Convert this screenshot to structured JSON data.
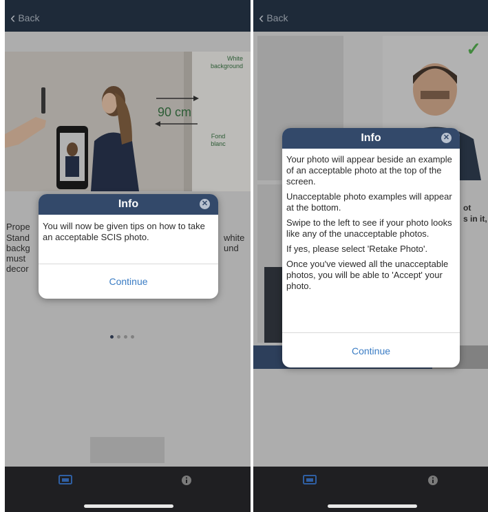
{
  "left": {
    "back_label": "Back",
    "photo": {
      "distance_label": "90 cm",
      "bg_label_en": "White background",
      "bg_label_fr": "Fond blanc"
    },
    "behind_text": {
      "title_partial": "Prope",
      "lines_left": [
        "Stand",
        "backg",
        "must",
        "decor"
      ],
      "lines_right": [
        "white",
        "und"
      ]
    },
    "dialog": {
      "title": "Info",
      "close_icon": "close-icon",
      "message": "You will now be given tips on how to take an acceptable SCIS photo.",
      "continue_label": "Continue"
    },
    "page_dots": {
      "count": 4,
      "active_index": 0
    },
    "tabs": [
      {
        "icon": "photo-icon"
      },
      {
        "icon": "info-icon"
      }
    ]
  },
  "right": {
    "back_label": "Back",
    "check_icon": "checkmark-icon",
    "behind_text": [
      "ot",
      "s in it,"
    ],
    "dialog": {
      "title": "Info",
      "close_icon": "close-icon",
      "paragraphs": [
        "Your photo will appear beside an example of an acceptable photo at the top of the screen.",
        "Unacceptable photo examples will appear at the bottom.",
        "Swipe to the left to see if your photo looks like any of the unacceptable photos.",
        "If yes, please select 'Retake Photo'.",
        "Once you've viewed all the unacceptable photos, you will be able to 'Accept' your photo."
      ],
      "continue_label": "Continue"
    },
    "tabs": [
      {
        "icon": "photo-icon"
      },
      {
        "icon": "info-icon"
      }
    ]
  },
  "colors": {
    "topbar": "#1c2b3e",
    "dialog_header": "#33496a",
    "link": "#3a7cc4",
    "check": "#4aa544",
    "tab_active": "#2f5fa3"
  }
}
